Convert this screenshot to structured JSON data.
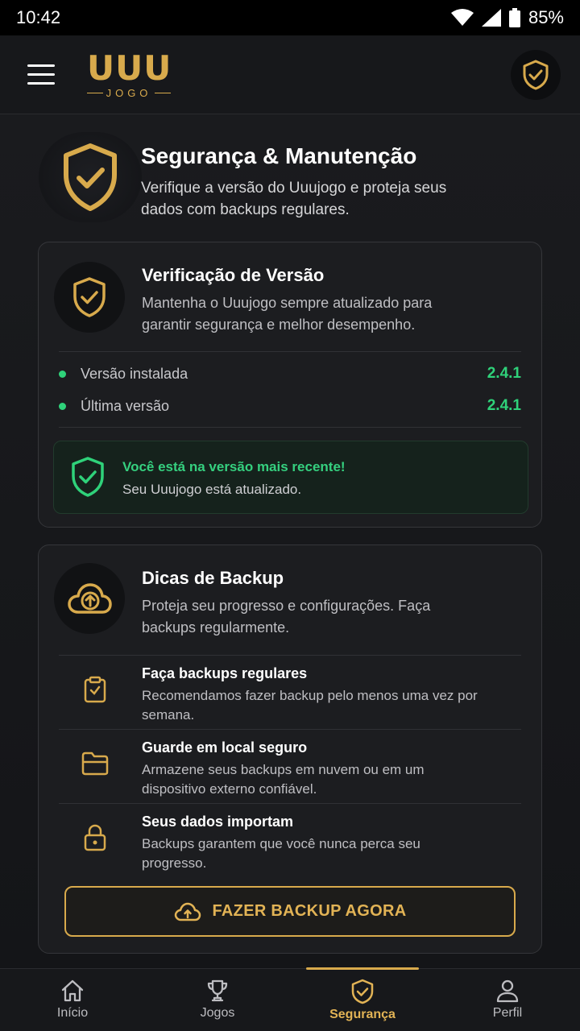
{
  "status_bar": {
    "time": "10:42",
    "battery": "85%"
  },
  "header": {
    "logo_main": "UUU",
    "logo_sub": "JOGO"
  },
  "hero": {
    "title": "Segurança & Manutenção",
    "description": "Verifique a versão do Uuujogo e proteja seus dados com backups regulares."
  },
  "version_card": {
    "title": "Verificação de Versão",
    "description": "Mantenha o Uuujogo sempre atualizado para garantir segurança e melhor desempenho.",
    "rows": [
      {
        "label": "Versão instalada",
        "value": "2.4.1"
      },
      {
        "label": "Última versão",
        "value": "2.4.1"
      }
    ],
    "status_title": "Você está na versão mais recente!",
    "status_text": "Seu Uuujogo está atualizado."
  },
  "backup_card": {
    "title": "Dicas de Backup",
    "description": "Proteja seu progresso e configurações. Faça backups regularmente.",
    "tips": [
      {
        "icon": "clipboard-icon",
        "title": "Faça backups regulares",
        "description": "Recomendamos fazer backup pelo menos uma vez por semana."
      },
      {
        "icon": "folder-icon",
        "title": "Guarde em local seguro",
        "description": "Armazene seus backups em nuvem ou em um dispositivo externo confiável."
      },
      {
        "icon": "lock-icon",
        "title": "Seus dados importam",
        "description": "Backups garantem que você nunca perca seu progresso."
      }
    ],
    "button_label": "FAZER BACKUP AGORA"
  },
  "bottom_nav": [
    {
      "label": "Início",
      "icon": "home-icon",
      "active": false
    },
    {
      "label": "Jogos",
      "icon": "trophy-icon",
      "active": false
    },
    {
      "label": "Segurança",
      "icon": "shield-check-icon",
      "active": true
    },
    {
      "label": "Perfil",
      "icon": "user-icon",
      "active": false
    }
  ],
  "colors": {
    "accent_gold": "#d8aa4c",
    "success_green": "#2fd27a",
    "background": "#141518",
    "card": "#1c1d20"
  }
}
